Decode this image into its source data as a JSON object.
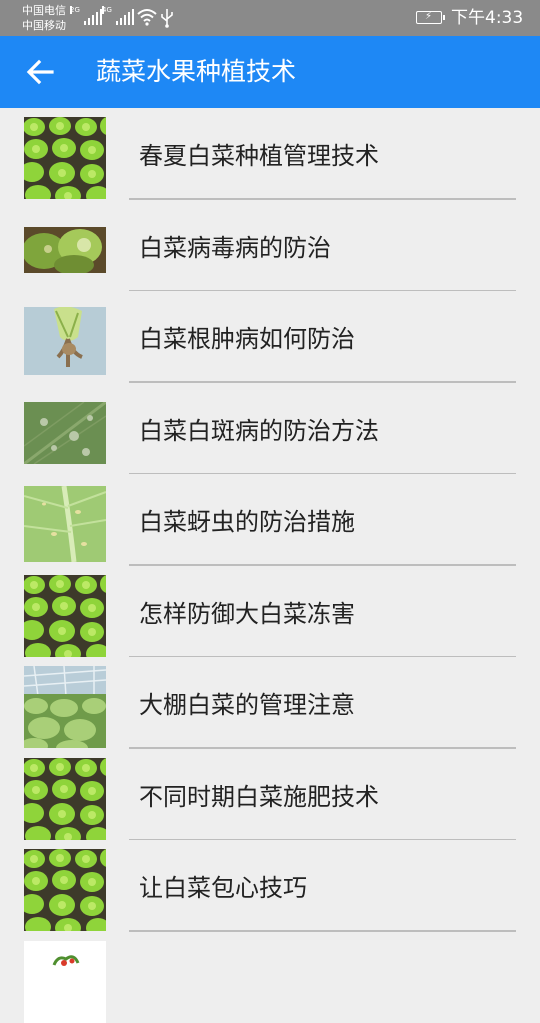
{
  "status_bar": {
    "carrier_1": "中国电信",
    "carrier_2": "中国移动",
    "signal_1_tag": "2G",
    "signal_2_tag": "4G",
    "time": "下午4:33",
    "icons": [
      "signal-icon",
      "signal-icon",
      "wifi-icon",
      "usb-icon",
      "battery-charging-icon"
    ]
  },
  "app_bar": {
    "back_icon": "arrow-left-icon",
    "title": "蔬菜水果种植技术",
    "background": "#1e88f5"
  },
  "articles": [
    {
      "title": "春夏白菜种植管理技术",
      "image": "cabbage-field"
    },
    {
      "title": "白菜病毒病的防治",
      "image": "diseased-cabbage"
    },
    {
      "title": "白菜根肿病如何防治",
      "image": "cabbage-root"
    },
    {
      "title": "白菜白斑病的防治方法",
      "image": "leaf-spots"
    },
    {
      "title": "白菜蚜虫的防治措施",
      "image": "aphid-leaf"
    },
    {
      "title": "怎样防御大白菜冻害",
      "image": "cabbage-field"
    },
    {
      "title": "大棚白菜的管理注意",
      "image": "greenhouse"
    },
    {
      "title": "不同时期白菜施肥技术",
      "image": "cabbage-field"
    },
    {
      "title": "让白菜包心技巧",
      "image": "cabbage-field"
    },
    {
      "title": "",
      "image": "plant-on-white"
    }
  ]
}
